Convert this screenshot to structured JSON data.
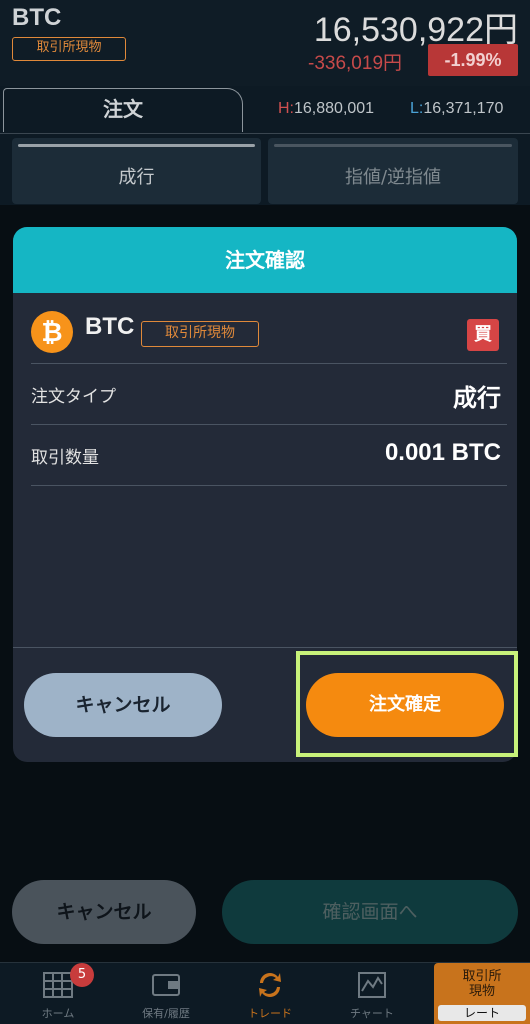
{
  "header": {
    "symbol": "BTC",
    "market_badge": "取引所現物",
    "price": "16,530,922円",
    "change": "-336,019円",
    "change_pct": "-1.99%",
    "high_label": "H:",
    "high_value": "16,880,001",
    "low_label": "L:",
    "low_value": "16,371,170"
  },
  "order_tab": {
    "label": "注文"
  },
  "order_types": [
    {
      "label": "成行"
    },
    {
      "label": "指値/逆指値"
    }
  ],
  "modal": {
    "title": "注文確認",
    "coin_icon_glyph": "₿",
    "coin": "BTC",
    "market_badge": "取引所現物",
    "side_badge": "買",
    "rows": [
      {
        "label": "注文タイプ",
        "value": "成行"
      },
      {
        "label": "取引数量",
        "value": "0.001 BTC"
      }
    ],
    "cancel_label": "キャンセル",
    "confirm_label": "注文確定"
  },
  "bottom": {
    "cancel_label": "キャンセル",
    "confirm_label": "確認画面へ"
  },
  "tabbar": {
    "home": "ホーム",
    "home_badge": "5",
    "holdings": "保有/履歴",
    "trade": "トレード",
    "chart": "チャート",
    "rate_line1": "取引所",
    "rate_line2": "現物",
    "rate_sub": "レート"
  },
  "colors": {
    "accent_orange": "#f58a0f",
    "modal_header": "#15b6c4",
    "highlight": "#c8f27a",
    "negative": "#b83737"
  }
}
